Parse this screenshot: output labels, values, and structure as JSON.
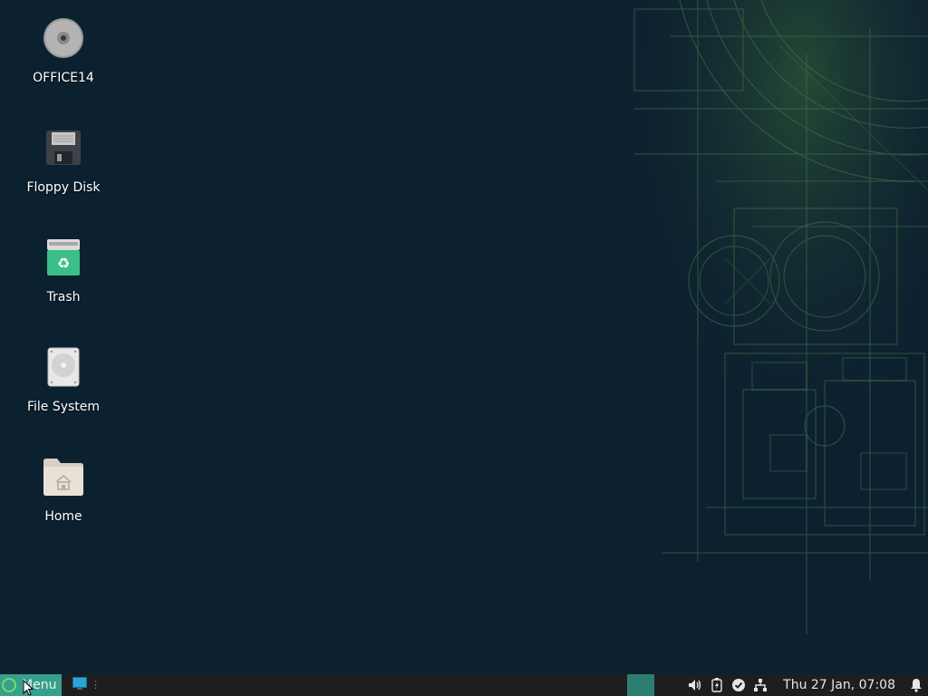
{
  "desktop": {
    "background_color": "#0c2130",
    "icons": [
      {
        "label": "OFFICE14",
        "icon": "optical-disc-icon"
      },
      {
        "label": "Floppy Disk",
        "icon": "floppy-disk-icon"
      },
      {
        "label": "Trash",
        "icon": "trash-icon"
      },
      {
        "label": "File System",
        "icon": "hard-drive-icon"
      },
      {
        "label": "Home",
        "icon": "home-folder-icon"
      }
    ]
  },
  "taskbar": {
    "menu_label": "Menu",
    "accent_color": "#35a08d",
    "tray_icons": [
      "volume-icon",
      "battery-icon",
      "update-check-icon",
      "network-icon"
    ],
    "clock": "Thu 27 Jan, 07:08",
    "notification_icon": "bell-icon"
  }
}
